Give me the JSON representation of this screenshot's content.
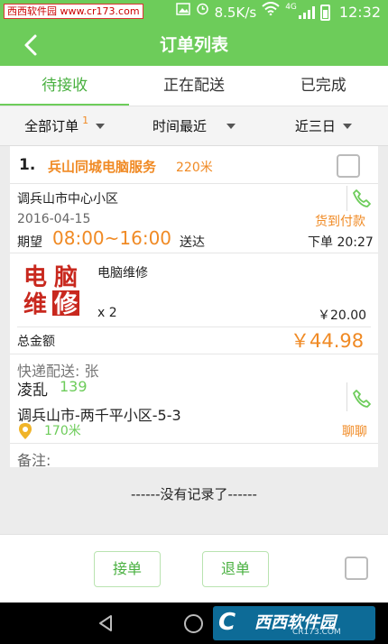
{
  "status_bar": {
    "watermark": "西西软件园 www.cr173.com",
    "net_speed": "8.5K/s",
    "network_type": "4G",
    "time": "12:32",
    "icons": [
      "image-icon",
      "gallery-icon",
      "alarm-icon",
      "wifi-icon",
      "signal-icon",
      "battery-icon"
    ]
  },
  "header": {
    "title": "订单列表"
  },
  "tabs": [
    {
      "label": "待接收",
      "active": true
    },
    {
      "label": "正在配送",
      "active": false
    },
    {
      "label": "已完成",
      "active": false
    }
  ],
  "filters": {
    "order_type": {
      "label": "全部订单",
      "count": "1"
    },
    "sort": {
      "label": "时间最近"
    },
    "range": {
      "label": "近三日"
    }
  },
  "order": {
    "index": "1.",
    "shop_name": "兵山同城电脑服务",
    "shop_distance": "220米",
    "shop_address": "调兵山市中心小区",
    "date": "2016-04-15",
    "payment": "货到付款",
    "expect_label": "期望",
    "expect_time": "08:00~16:00",
    "deliver_label": "送达",
    "order_time": "下单 20:27",
    "goods": {
      "logo_text": [
        "电",
        "脑",
        "维",
        "修"
      ],
      "name": "电脑维修",
      "quantity": "x 2",
      "price": "￥20.00"
    },
    "total_label": "总金额",
    "total_value": "￥44.98",
    "express": "快递配送:   张",
    "receiver_name": "凌乱",
    "receiver_phone": "139",
    "receiver_address": "调兵山市-两千平小区-5-3",
    "receiver_distance": "170米",
    "chat_label": "聊聊",
    "note_label": "备注:"
  },
  "list_end_text": "------没有记录了------",
  "actions": {
    "accept": "接单",
    "reject": "退单"
  },
  "branding": {
    "logo_text": "西西软件园",
    "logo_sub": "CR173.COM",
    "logo_mark": "C"
  },
  "colors": {
    "accent_green": "#6dcc5a",
    "orange": "#f08a24",
    "logo_red": "#c8281e"
  }
}
